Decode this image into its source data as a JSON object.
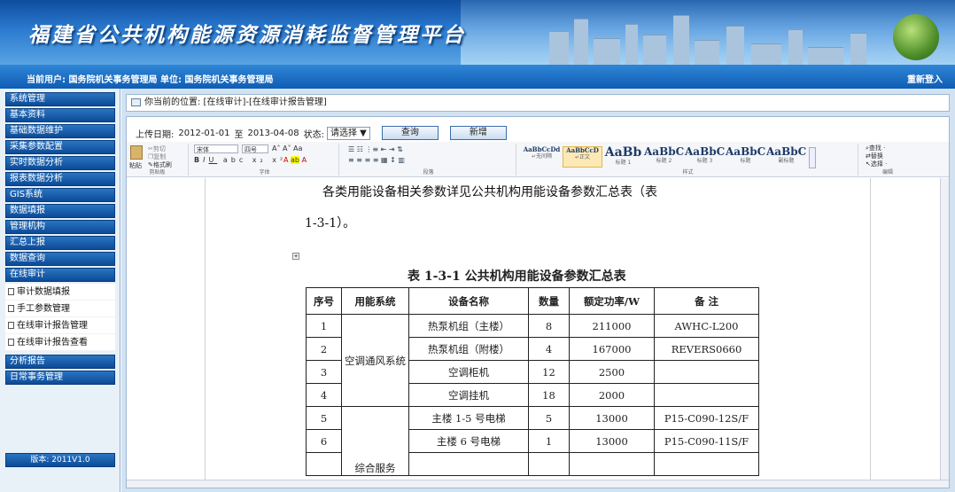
{
  "header": {
    "title": "福建省公共机构能源资源消耗监督管理平台"
  },
  "userbar": {
    "user_info": "当前用户: 国务院机关事务管理局  单位: 国务院机关事务管理局",
    "relogin": "重新登入"
  },
  "sidebar": {
    "items_top": [
      {
        "label": "系统管理"
      },
      {
        "label": "基本资料"
      },
      {
        "label": "基础数据维护"
      },
      {
        "label": "采集参数配置"
      },
      {
        "label": "实时数据分析"
      },
      {
        "label": "报表数据分析"
      },
      {
        "label": "GIS系统"
      },
      {
        "label": "数据填报"
      },
      {
        "label": "管理机构"
      },
      {
        "label": "汇总上报"
      },
      {
        "label": "数据查询"
      },
      {
        "label": "在线审计"
      }
    ],
    "sub_items": [
      {
        "label": "审计数据填报"
      },
      {
        "label": "手工参数管理"
      },
      {
        "label": "在线审计报告管理"
      },
      {
        "label": "在线审计报告查看"
      }
    ],
    "items_bottom": [
      {
        "label": "分析报告"
      },
      {
        "label": "日常事务管理"
      }
    ],
    "version": "版本: 2011V1.0"
  },
  "breadcrumb": "你当前的位置: [在线审计]-[在线审计报告管理]",
  "filters": {
    "date_label": "上传日期:",
    "start_date": "2012-01-01",
    "to_label": "至",
    "end_date": "2013-04-08",
    "status_label": "状态:",
    "status_value": "请选择 ▼",
    "query_button": "查询",
    "add_button": "新增"
  },
  "ribbon": {
    "clipboard": {
      "paste": "粘贴",
      "cut": "剪切",
      "copy": "复制",
      "format_painter": "格式刷",
      "group": "剪贴板"
    },
    "font": {
      "name": "宋体",
      "size": "四号",
      "group": "字体"
    },
    "paragraph": {
      "group": "段落"
    },
    "styles": {
      "items": [
        {
          "sample": "AaBbCcDd",
          "name": "↵无间隔"
        },
        {
          "sample": "AaBbCcD",
          "name": "↵正文"
        },
        {
          "sample": "AaBb",
          "name": "标题 1"
        },
        {
          "sample": "AaBbC",
          "name": "标题 2"
        },
        {
          "sample": "AaBbC",
          "name": "标题 3"
        },
        {
          "sample": "AaBbC",
          "name": "标题"
        },
        {
          "sample": "AaBbC",
          "name": "副标题"
        }
      ],
      "group": "样式"
    },
    "editing": {
      "find": "查找 ·",
      "replace": "替换",
      "select": "选择 ·",
      "group": "编辑"
    }
  },
  "document": {
    "para1": "各类用能设备相关参数详见公共机构用能设备参数汇总表（表",
    "para2": "1-3-1）。",
    "table_caption": "表 1-3-1  公共机构用能设备参数汇总表",
    "headers": [
      "序号",
      "用能系统",
      "设备名称",
      "数量",
      "额定功率/W",
      "备  注"
    ],
    "group1": "空调通风系统",
    "group2": "综合服务",
    "rows": [
      {
        "no": "1",
        "name": "热泵机组（主楼）",
        "qty": "8",
        "power": "211000",
        "note": "AWHC-L200"
      },
      {
        "no": "2",
        "name": "热泵机组（附楼）",
        "qty": "4",
        "power": "167000",
        "note": "REVERS0660"
      },
      {
        "no": "3",
        "name": "空调柜机",
        "qty": "12",
        "power": "2500",
        "note": ""
      },
      {
        "no": "4",
        "name": "空调挂机",
        "qty": "18",
        "power": "2000",
        "note": ""
      },
      {
        "no": "5",
        "name": "主楼 1-5 号电梯",
        "qty": "5",
        "power": "13000",
        "note": "P15-C090-12S/F"
      },
      {
        "no": "6",
        "name": "主楼 6 号电梯",
        "qty": "1",
        "power": "13000",
        "note": "P15-C090-11S/F"
      }
    ]
  },
  "colors": {
    "header_dark": "#0e4d9e",
    "menu_blue": "#0c4a96",
    "page_bg": "#d3e2f1"
  }
}
